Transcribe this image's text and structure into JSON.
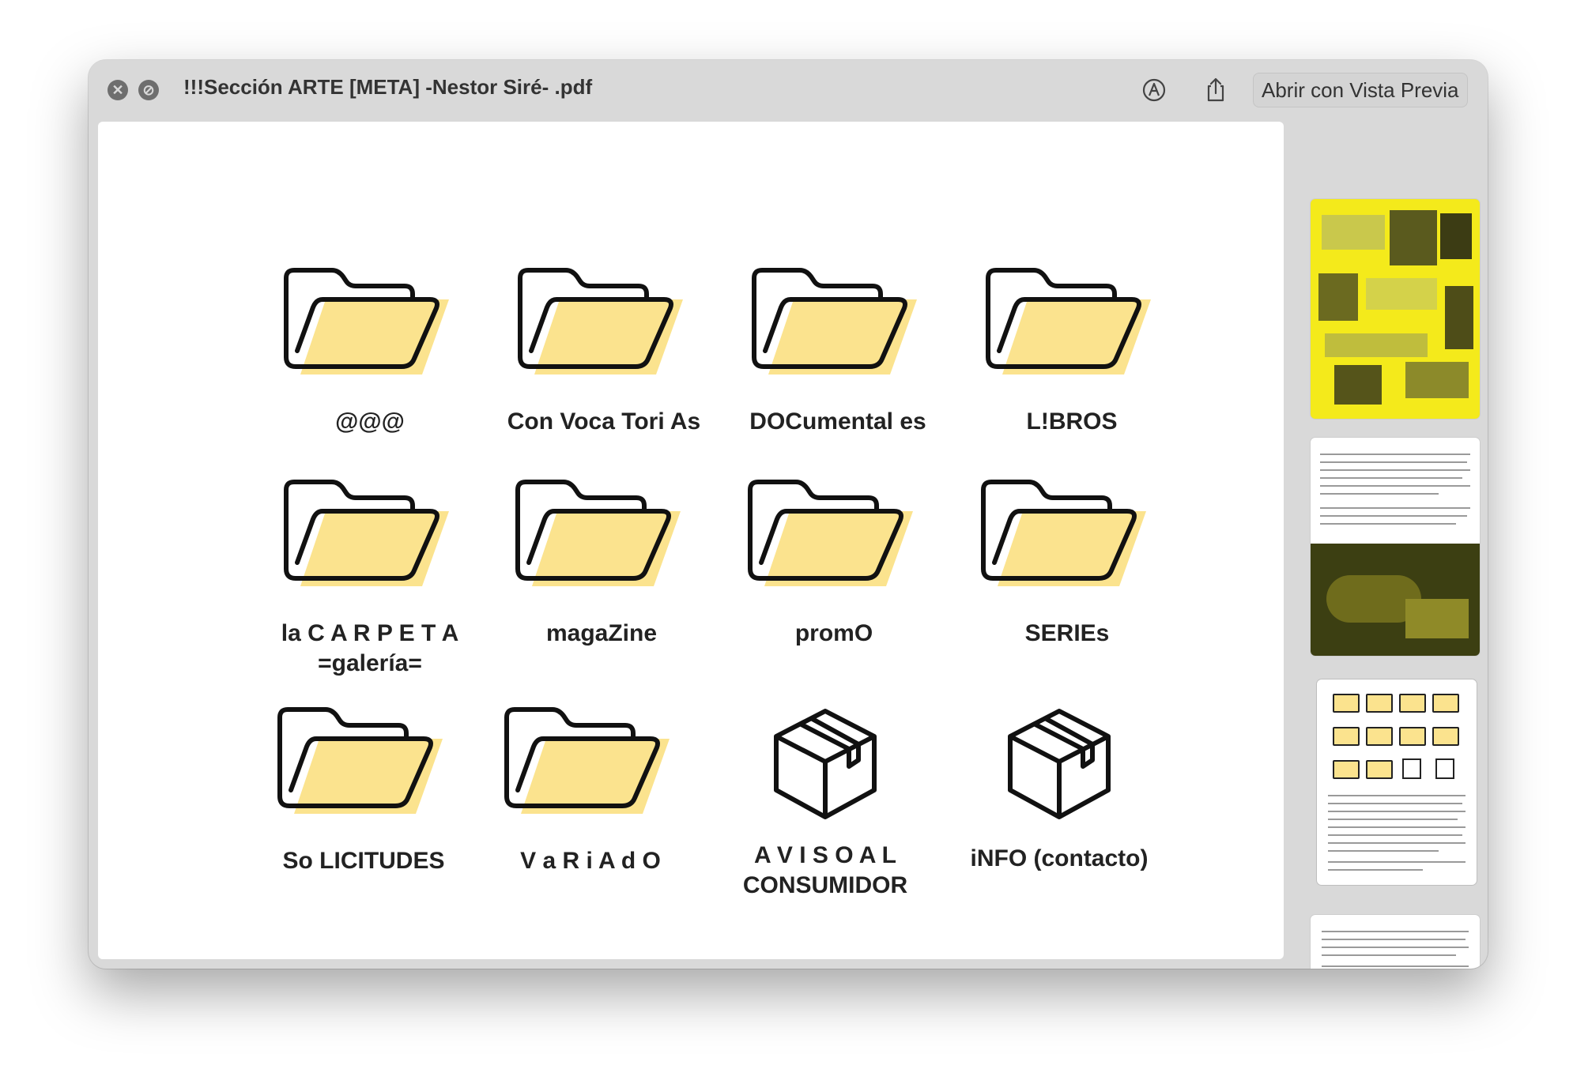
{
  "window": {
    "title": "!!!Sección ARTE [META] -Nestor Siré- .pdf",
    "open_button_label": "Abrir con Vista Previa",
    "close_glyph": "✕",
    "block_glyph": "⊘",
    "markup_icon": "markup-icon",
    "share_icon": "share-icon"
  },
  "colors": {
    "folder_fill": "#fbe38e",
    "stroke": "#111111",
    "thumb_yellow": "#f4ea1b"
  },
  "items": [
    {
      "label": "@@@",
      "icon": "folder-icon"
    },
    {
      "label": "Con Voca Tori As",
      "icon": "folder-icon"
    },
    {
      "label": "DOCumental es",
      "icon": "folder-icon"
    },
    {
      "label": "L!BROS",
      "icon": "folder-icon"
    },
    {
      "label": "la C A R P E T A\n=galería=",
      "icon": "folder-icon"
    },
    {
      "label": "magaZine",
      "icon": "folder-icon"
    },
    {
      "label": "promO",
      "icon": "folder-icon"
    },
    {
      "label": "SERIEs",
      "icon": "folder-icon"
    },
    {
      "label": "So LICITUDES",
      "icon": "folder-icon"
    },
    {
      "label": "V a R i A d O",
      "icon": "folder-icon"
    },
    {
      "label": "A V I S O  A L\nCONSUMIDOR",
      "icon": "box-icon"
    },
    {
      "label": "iNFO (contacto)",
      "icon": "box-icon"
    }
  ],
  "thumbnails": [
    {
      "page": 1,
      "kind": "collage"
    },
    {
      "page": 2,
      "kind": "text-photo"
    },
    {
      "page": 3,
      "kind": "folder-grid"
    },
    {
      "page": 4,
      "kind": "text"
    }
  ]
}
